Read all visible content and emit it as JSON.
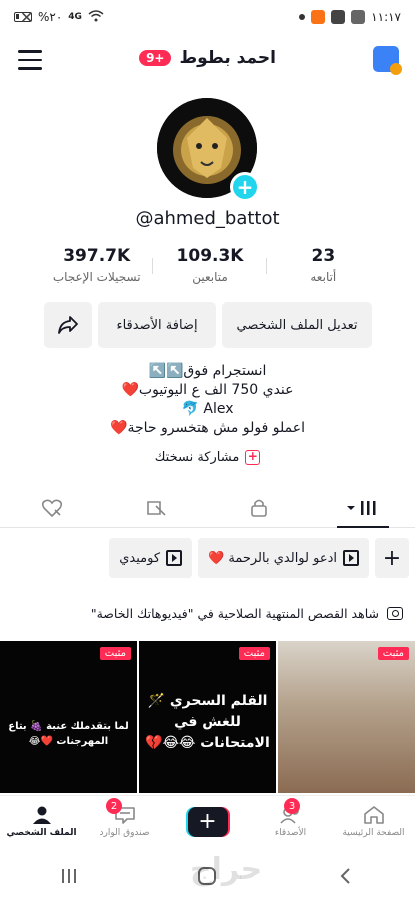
{
  "status_bar": {
    "time": "١١:١٧",
    "battery": "%٢٠",
    "network": "4G"
  },
  "header": {
    "title": "احمد بطوط",
    "notification_badge": "9+"
  },
  "profile": {
    "handle": "@ahmed_battot",
    "stats": [
      {
        "value": "23",
        "label": "أتابعه"
      },
      {
        "value": "109.3K",
        "label": "متابعين"
      },
      {
        "value": "397.7K",
        "label": "تسجيلات الإعجاب"
      }
    ],
    "buttons": {
      "edit": "تعديل الملف الشخصي",
      "add_friends": "إضافة الأصدقاء"
    },
    "bio_lines": [
      "انستجرام فوق↖️↖️",
      "عندي 750 الف ع اليوتيوب❤️",
      "Alex 🐬",
      "اعملو فولو مش هتخسرو حاجة❤️"
    ],
    "share_collection": "مشاركة نسختك"
  },
  "playlists": [
    {
      "label": "ادعو لوالدي بالرحمة ❤️"
    },
    {
      "label": "كوميدي"
    }
  ],
  "banner": {
    "text": "شاهد القصص المنتهية الصلاحية في \"فيديوهاتك الخاصة\""
  },
  "videos": [
    {
      "pinned": "مثبت",
      "text": "لما بتقدملك عنبة 🍇 بتاع المهرجنات ❤️😂"
    },
    {
      "pinned": "مثبت",
      "text": "القلم السحري 🪄 للغش في الامتحانات 😂😂💔"
    },
    {
      "pinned": "مثبت",
      "text": ""
    }
  ],
  "bottom_nav": [
    {
      "label": "الصفحة الرئيسية",
      "badge": ""
    },
    {
      "label": "الأصدقاء",
      "badge": "3"
    },
    {
      "label": "",
      "badge": ""
    },
    {
      "label": "صندوق الوارد",
      "badge": "2"
    },
    {
      "label": "الملف الشخصي",
      "badge": ""
    }
  ],
  "watermark": "حراج",
  "colors": {
    "accent": "#fe2c55",
    "cyan": "#20d5ec",
    "text": "#161823"
  }
}
